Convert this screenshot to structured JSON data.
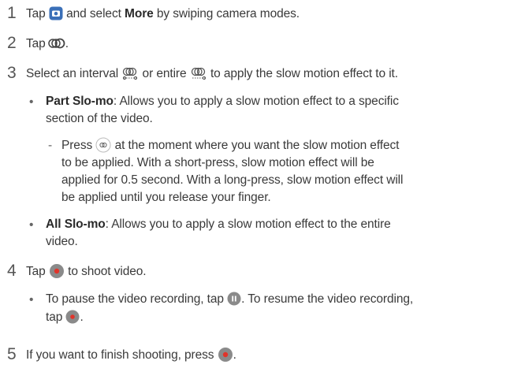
{
  "steps": {
    "s1": {
      "num": "1",
      "a": "Tap",
      "b": "and select",
      "bold": "More",
      "c": "by swiping camera modes."
    },
    "s2": {
      "num": "2",
      "a": "Tap",
      "b": "."
    },
    "s3": {
      "num": "3",
      "a": "Select an interval",
      "b": "or entire",
      "c": "to apply the slow motion effect to it."
    },
    "part": {
      "title": "Part Slo-mo",
      "l1": ": Allows you to apply a slow motion effect to a specific",
      "l2": "section of the video."
    },
    "press": {
      "dash": "-",
      "a": "Press",
      "b": "at the moment where you want the slow motion effect",
      "l2": "to be applied. With a short-press, slow motion effect will be",
      "l3": "applied for 0.5 second. With a long-press, slow motion effect will",
      "l4": "be applied until you release your finger."
    },
    "all": {
      "title": "All Slo-mo",
      "l1": ": Allows you to apply a slow motion effect to the entire",
      "l2": "video."
    },
    "s4": {
      "num": "4",
      "a": "Tap",
      "b": "to shoot video."
    },
    "pause": {
      "a": "To pause the video recording, tap",
      "b": ". To resume the video recording,",
      "c": "tap",
      "d": "."
    },
    "s5": {
      "num": "5",
      "a": "If you want to finish shooting, press",
      "b": "."
    }
  },
  "bullet_char": "•",
  "colors": {
    "camera_blue": "#3a6fb8",
    "record_red": "#e0342b",
    "icon_gray": "#8a8a8a"
  }
}
